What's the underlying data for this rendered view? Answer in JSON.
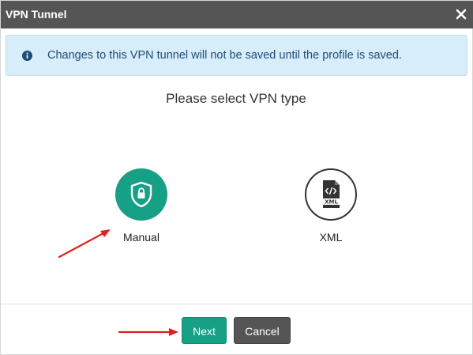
{
  "dialog": {
    "title": "VPN Tunnel",
    "close_icon": "close-icon"
  },
  "alert": {
    "icon": "info-circle-icon",
    "message": "Changes to this VPN tunnel will not be saved until the profile is saved."
  },
  "prompt": "Please select VPN type",
  "options": [
    {
      "label": "Manual",
      "icon": "shield-lock-icon",
      "color": "#16a085"
    },
    {
      "label": "XML",
      "icon": "xml-file-icon",
      "color": "#333333"
    }
  ],
  "buttons": {
    "next_label": "Next",
    "cancel_label": "Cancel"
  },
  "colors": {
    "titlebar": "#555555",
    "accent": "#16a085",
    "alert_bg": "#d8edfa",
    "alert_text": "#1d4c7a",
    "annotation_arrow": "#e02020"
  },
  "annotations": {
    "arrow_icon": "red-arrow-icon",
    "count": 2
  }
}
